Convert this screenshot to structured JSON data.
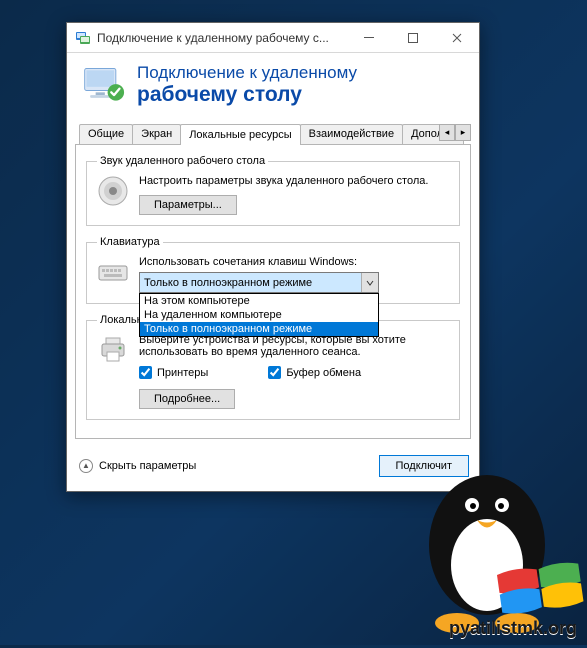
{
  "window": {
    "title": "Подключение к удаленному рабочему с..."
  },
  "banner": {
    "line1": "Подключение к удаленному",
    "line2": "рабочему столу"
  },
  "tabs": {
    "items": [
      {
        "label": "Общие"
      },
      {
        "label": "Экран"
      },
      {
        "label": "Локальные ресурсы"
      },
      {
        "label": "Взаимодействие"
      },
      {
        "label": "Дополни"
      }
    ]
  },
  "audio_group": {
    "legend": "Звук удаленного рабочего стола",
    "desc": "Настроить параметры звука удаленного рабочего стола.",
    "settings_btn": "Параметры..."
  },
  "keyboard_group": {
    "legend": "Клавиатура",
    "desc": "Использовать сочетания клавиш Windows:",
    "selected": "Только в полноэкранном режиме",
    "options": [
      "На этом компьютере",
      "На удаленном компьютере",
      "Только в полноэкранном режиме"
    ]
  },
  "local_group": {
    "legend": "Локальные устройства и ресурсы",
    "desc": "Выберите устройства и ресурсы, которые вы хотите использовать во время удаленного сеанса.",
    "printers": "Принтеры",
    "clipboard": "Буфер обмена",
    "more_btn": "Подробнее..."
  },
  "footer": {
    "hide": "Скрыть параметры",
    "connect": "Подключит"
  },
  "watermark": "pyatilistmk.org"
}
